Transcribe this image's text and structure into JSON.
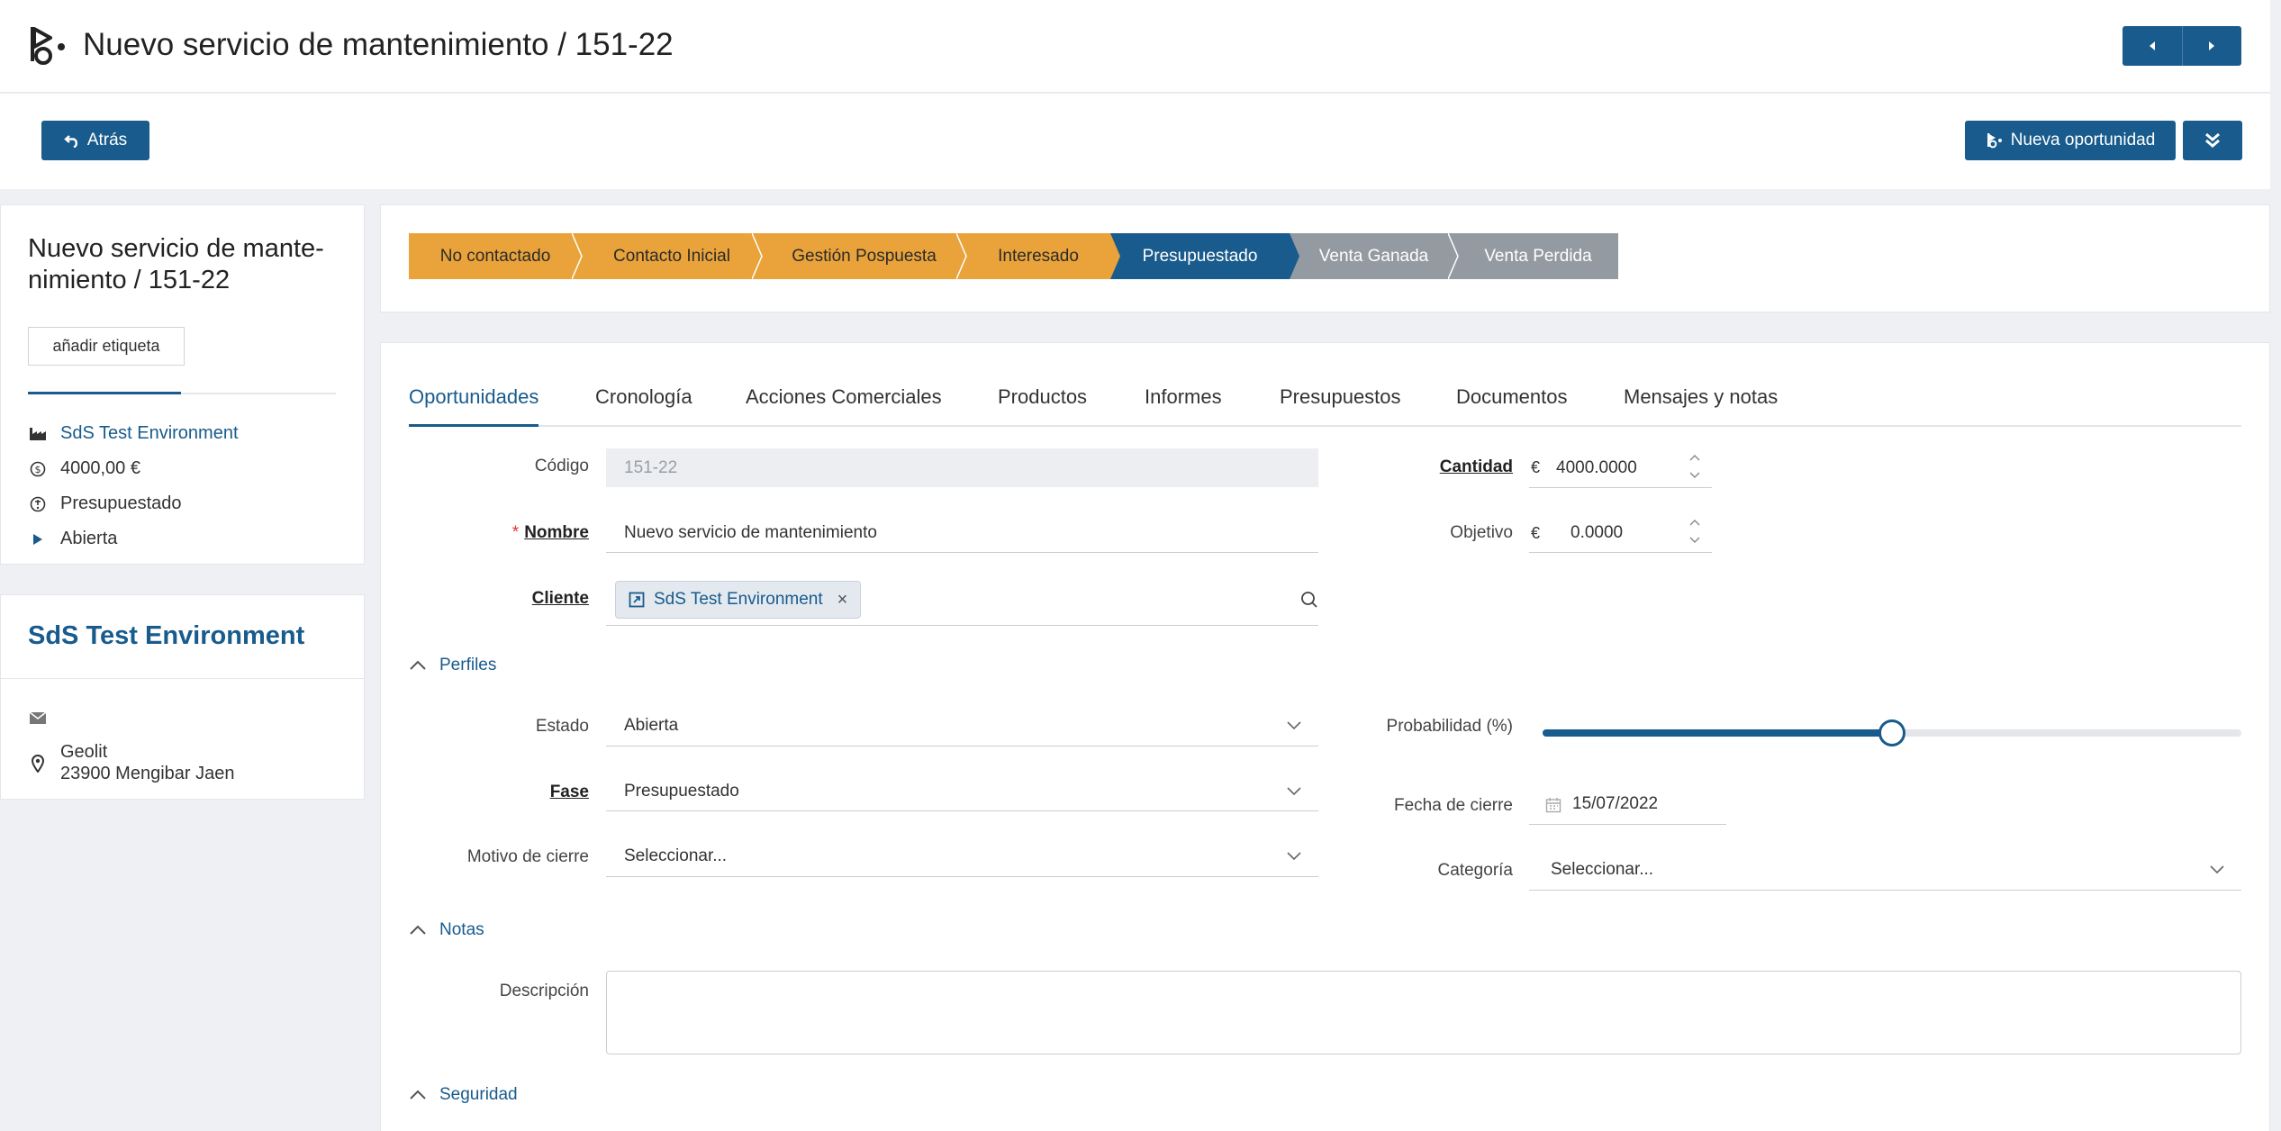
{
  "header": {
    "title": "Nuevo servicio de mantenimiento / 151-22",
    "logo_icon": "opportunity-flag-icon"
  },
  "toolbar": {
    "back_label": "Atrás",
    "new_opportunity_label": "Nueva oportunidad"
  },
  "summary": {
    "title": "Nuevo servicio de mante-nimiento / 151-22",
    "tag_button": "añadir etiqueta",
    "client": "SdS Test Environment",
    "amount": "4000,00 €",
    "phase": "Presupuestado",
    "status": "Abierta"
  },
  "client_card": {
    "name": "SdS Test Environment",
    "address_line1": "Geolit",
    "address_line2": "23900 Mengibar Jaen"
  },
  "stages": [
    {
      "label": "No contactado",
      "state": "done"
    },
    {
      "label": "Contacto Inicial",
      "state": "done"
    },
    {
      "label": "Gestión Pospuesta",
      "state": "done"
    },
    {
      "label": "Interesado",
      "state": "done"
    },
    {
      "label": "Presupuestado",
      "state": "current"
    },
    {
      "label": "Venta Ganada",
      "state": "todo"
    },
    {
      "label": "Venta Perdida",
      "state": "todo"
    }
  ],
  "tabs": [
    {
      "label": "Oportunidades",
      "active": true
    },
    {
      "label": "Cronología"
    },
    {
      "label": "Acciones Comerciales"
    },
    {
      "label": "Productos"
    },
    {
      "label": "Informes"
    },
    {
      "label": "Presupuestos"
    },
    {
      "label": "Documentos"
    },
    {
      "label": "Mensajes y notas"
    }
  ],
  "form": {
    "codigo_label": "Código",
    "codigo_value": "151-22",
    "nombre_label": "Nombre",
    "nombre_value": "Nuevo servicio de mantenimiento",
    "cliente_label": "Cliente",
    "cliente_value": "SdS Test Environment",
    "cantidad_label": "Cantidad",
    "cantidad_currency": "€",
    "cantidad_value": "4000.0000",
    "objetivo_label": "Objetivo",
    "objetivo_currency": "€",
    "objetivo_value": "0.0000",
    "perfiles_section": "Perfiles",
    "estado_label": "Estado",
    "estado_value": "Abierta",
    "fase_label": "Fase",
    "fase_value": "Presupuestado",
    "motivo_label": "Motivo de cierre",
    "motivo_value": "Seleccionar...",
    "probabilidad_label": "Probabilidad (%)",
    "probabilidad_value": 50,
    "fecha_label": "Fecha de cierre",
    "fecha_value": "15/07/2022",
    "categoria_label": "Categoría",
    "categoria_value": "Seleccionar...",
    "notas_section": "Notas",
    "descripcion_label": "Descripción",
    "descripcion_value": "",
    "seguridad_section": "Seguridad"
  },
  "colors": {
    "primary": "#185b8c",
    "stage_done": "#e9a33a",
    "stage_todo": "#949aa1"
  }
}
